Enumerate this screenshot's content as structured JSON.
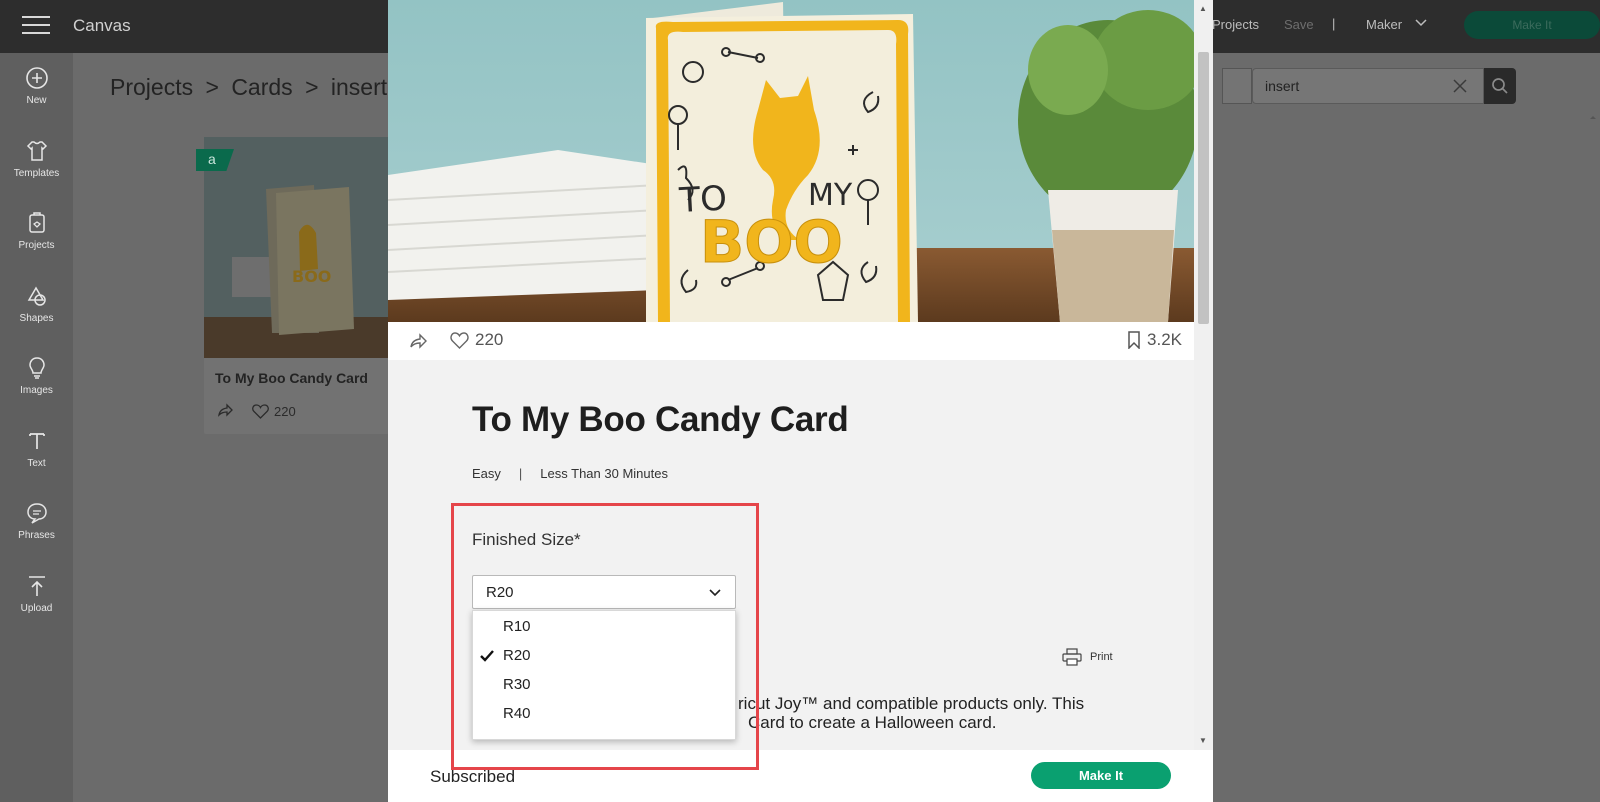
{
  "app": {
    "title": "Canvas"
  },
  "topbar": {
    "projects_label": "Projects",
    "save_label": "Save",
    "separator": "|",
    "machine_label": "Maker",
    "make_it_label": "Make It"
  },
  "sidebar": {
    "items": [
      {
        "label": "New",
        "icon": "plus-circle-icon"
      },
      {
        "label": "Templates",
        "icon": "shirt-icon"
      },
      {
        "label": "Projects",
        "icon": "projects-icon"
      },
      {
        "label": "Shapes",
        "icon": "shapes-icon"
      },
      {
        "label": "Images",
        "icon": "lightbulb-icon"
      },
      {
        "label": "Text",
        "icon": "text-icon"
      },
      {
        "label": "Phrases",
        "icon": "speech-bubble-icon"
      },
      {
        "label": "Upload",
        "icon": "upload-icon"
      }
    ]
  },
  "breadcrumb": {
    "items": [
      "Projects",
      ">",
      "Cards",
      ">",
      "insert"
    ]
  },
  "search": {
    "value": "insert"
  },
  "project_card": {
    "badge": "a",
    "name": "To My Boo Candy Card",
    "likes": "220"
  },
  "modal": {
    "stats": {
      "likes": "220",
      "saves": "3.2K"
    },
    "title": "To My Boo Candy Card",
    "difficulty": "Easy",
    "meta_sep": "|",
    "duration": "Less Than 30 Minutes",
    "finished_size_label": "Finished Size*",
    "finished_size_value": "R20",
    "size_options": [
      {
        "label": "R10",
        "selected": false
      },
      {
        "label": "R20",
        "selected": true
      },
      {
        "label": "R30",
        "selected": false
      },
      {
        "label": "R40",
        "selected": false
      }
    ],
    "print_label": "Print",
    "description_line1": "ricut Joy™ and compatible products only. This",
    "description_line2": "Card to create a Halloween card.",
    "footer": {
      "status": "Subscribed",
      "make_it_label": "Make It"
    }
  },
  "colors": {
    "accent": "#0aa070",
    "highlight": "#e5454a",
    "card_yellow": "#f1b51c"
  }
}
